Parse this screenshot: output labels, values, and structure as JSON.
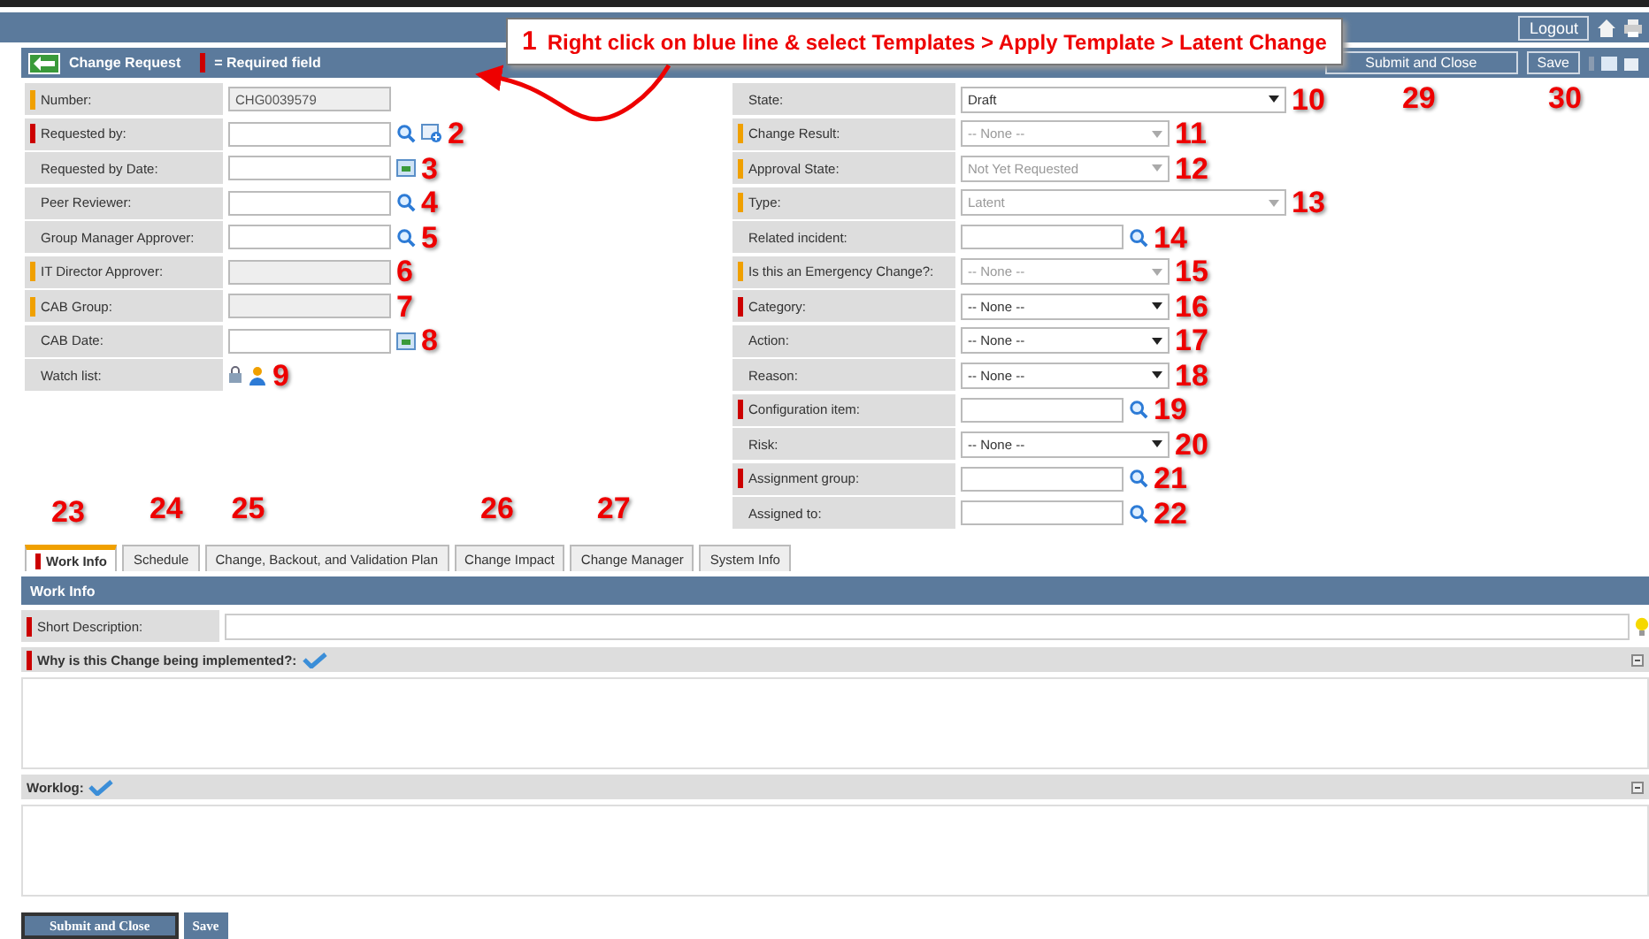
{
  "banner": {
    "logout": "Logout"
  },
  "form_header": {
    "title": "Change Request",
    "required_legend": "= Required field",
    "buttons": [
      {
        "label": "Submit and Close",
        "callout": "29"
      },
      {
        "label": "Save",
        "callout": "30"
      }
    ]
  },
  "annotation": {
    "number": "1",
    "text": "Right click on blue line & select Templates > Apply Template > Latent Change"
  },
  "left_fields": [
    {
      "label": "Number:",
      "kind": "readonly",
      "value": "CHG0039579",
      "color": "#f0a000"
    },
    {
      "label": "Requested by:",
      "kind": "reference_add",
      "color": "#cc0000",
      "callout": "2"
    },
    {
      "label": "Requested by Date:",
      "kind": "date",
      "callout": "3"
    },
    {
      "label": "Peer Reviewer:",
      "kind": "reference",
      "callout": "4"
    },
    {
      "label": "Group Manager Approver:",
      "kind": "reference",
      "callout": "5"
    },
    {
      "label": "IT Director Approver:",
      "kind": "readonly",
      "color": "#f0a000",
      "callout": "6"
    },
    {
      "label": "CAB Group:",
      "kind": "readonly",
      "color": "#f0a000",
      "callout": "7"
    },
    {
      "label": "CAB Date:",
      "kind": "date",
      "callout": "8"
    },
    {
      "label": "Watch list:",
      "kind": "watchlist",
      "callout": "9"
    }
  ],
  "right_fields": [
    {
      "label": "State:",
      "kind": "select",
      "value": "Draft",
      "wide": true,
      "disabled": false,
      "callout": "10"
    },
    {
      "label": "Change Result:",
      "kind": "select",
      "value": "-- None --",
      "disabled": true,
      "color": "#f0a000",
      "callout": "11"
    },
    {
      "label": "Approval State:",
      "kind": "select",
      "value": "Not Yet Requested",
      "disabled": true,
      "color": "#f0a000",
      "callout": "12"
    },
    {
      "label": "Type:",
      "kind": "select",
      "value": "Latent",
      "wide": true,
      "disabled": true,
      "color": "#f0a000",
      "callout": "13"
    },
    {
      "label": "Related incident:",
      "kind": "reference",
      "callout": "14"
    },
    {
      "label": "Is this an Emergency Change?:",
      "kind": "select",
      "value": "-- None --",
      "disabled": true,
      "color": "#f0a000",
      "callout": "15"
    },
    {
      "label": "Category:",
      "kind": "select",
      "value": "-- None --",
      "disabled": false,
      "color": "#cc0000",
      "callout": "16"
    },
    {
      "label": "Action:",
      "kind": "select",
      "value": "-- None --",
      "disabled": false,
      "callout": "17"
    },
    {
      "label": "Reason:",
      "kind": "select",
      "value": "-- None --",
      "disabled": false,
      "callout": "18"
    },
    {
      "label": "Configuration item:",
      "kind": "reference",
      "color": "#cc0000",
      "callout": "19"
    },
    {
      "label": "Risk:",
      "kind": "select",
      "value": "-- None --",
      "disabled": false,
      "callout": "20"
    },
    {
      "label": "Assignment group:",
      "kind": "reference",
      "color": "#cc0000",
      "callout": "21"
    },
    {
      "label": "Assigned to:",
      "kind": "reference",
      "callout": "22"
    }
  ],
  "tabs": [
    {
      "label": "Work Info",
      "selected": true,
      "callout": "23"
    },
    {
      "label": "Schedule",
      "selected": false,
      "callout": "24"
    },
    {
      "label": "Change, Backout, and Validation Plan",
      "selected": false,
      "callout": "25"
    },
    {
      "label": "Change Impact",
      "selected": false,
      "callout": "26"
    },
    {
      "label": "Change Manager",
      "selected": false,
      "callout": "27"
    },
    {
      "label": "System Info",
      "selected": false
    }
  ],
  "section": {
    "title": "Work Info",
    "short_description": {
      "label": "Short Description:",
      "color": "#cc0000"
    },
    "journal_fields": [
      {
        "label": "Why is this Change being implemented?:",
        "color": "#cc0000"
      },
      {
        "label": "Worklog:"
      }
    ]
  },
  "bottom_buttons": [
    {
      "label": "Submit and Close",
      "kind": "primary"
    },
    {
      "label": "Save",
      "kind": "secondary"
    }
  ]
}
